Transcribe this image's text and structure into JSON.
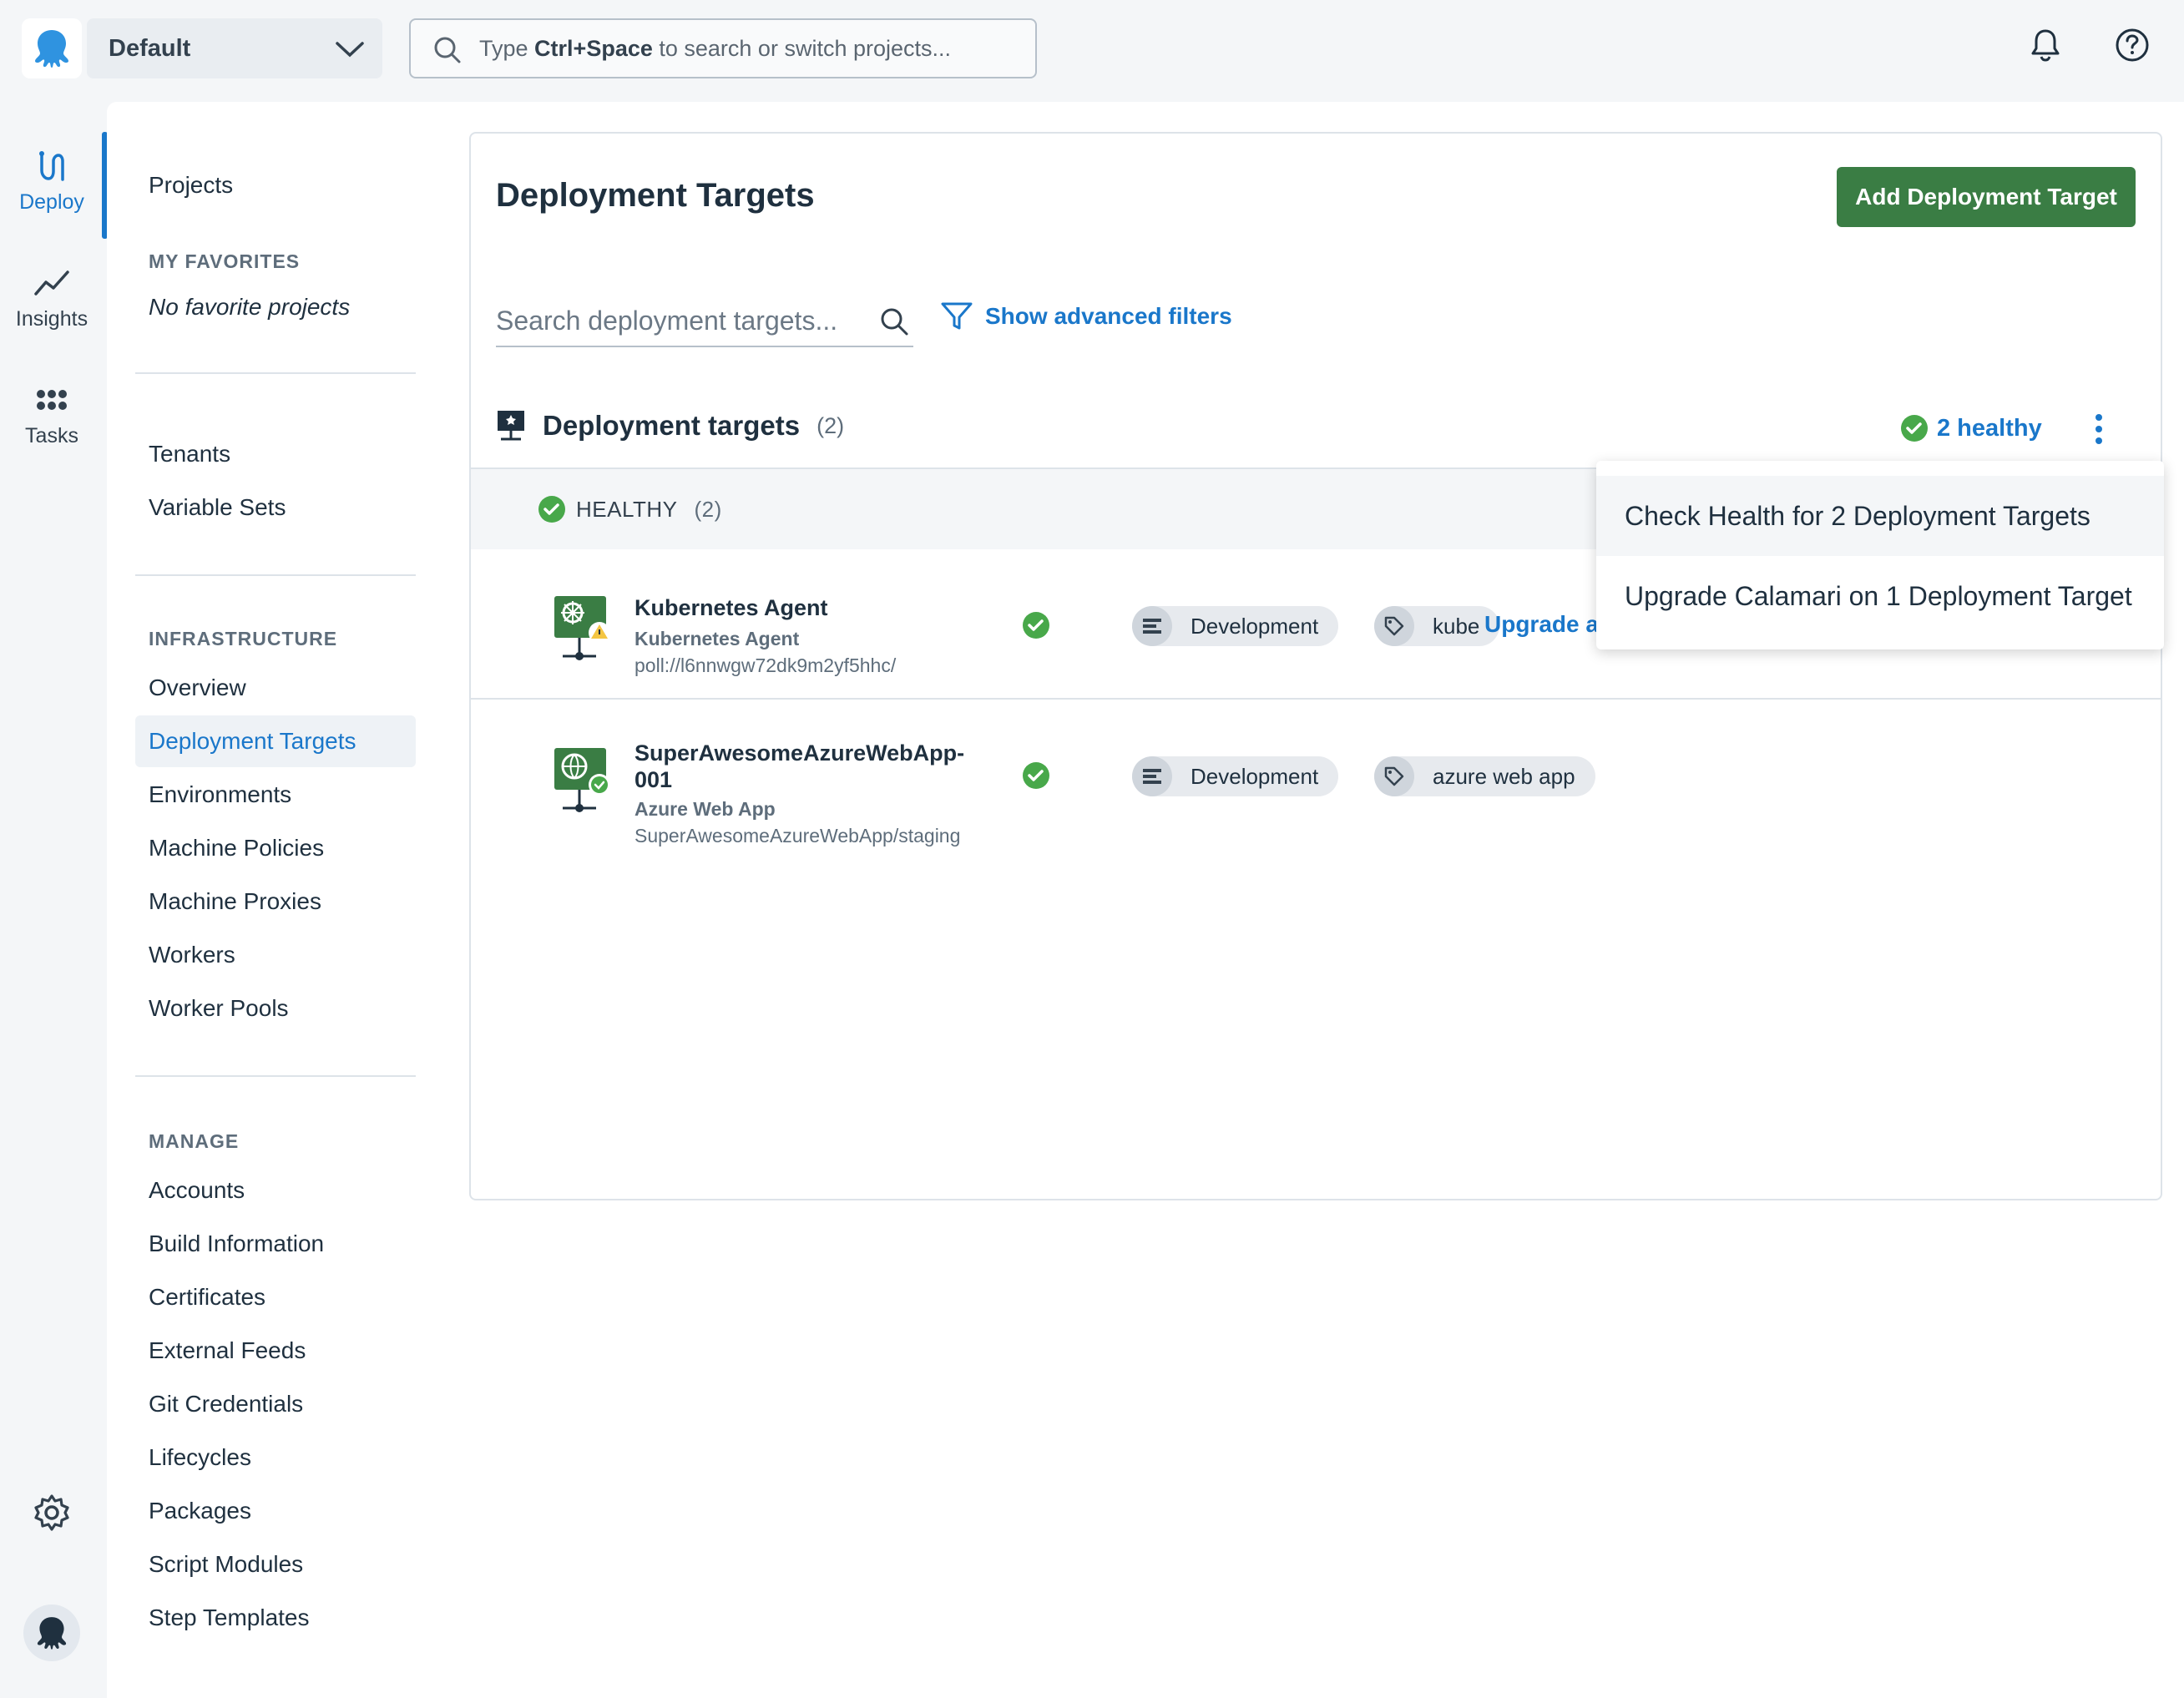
{
  "topbar": {
    "space_name": "Default",
    "search_placeholder_prefix": "Type ",
    "search_shortcut": "Ctrl+Space",
    "search_placeholder_suffix": " to search or switch projects..."
  },
  "rail": {
    "items": [
      {
        "label": "Deploy",
        "icon": "deploy-icon",
        "active": true
      },
      {
        "label": "Insights",
        "icon": "chart-line-icon",
        "active": false
      },
      {
        "label": "Tasks",
        "icon": "grid-dots-icon",
        "active": false
      }
    ]
  },
  "nav": {
    "projects": "Projects",
    "favorites_heading": "MY FAVORITES",
    "favorites_empty": "No favorite projects",
    "tenants": "Tenants",
    "variable_sets": "Variable Sets",
    "infrastructure_heading": "INFRASTRUCTURE",
    "infrastructure": [
      "Overview",
      "Deployment Targets",
      "Environments",
      "Machine Policies",
      "Machine Proxies",
      "Workers",
      "Worker Pools"
    ],
    "manage_heading": "MANAGE",
    "manage": [
      "Accounts",
      "Build Information",
      "Certificates",
      "External Feeds",
      "Git Credentials",
      "Lifecycles",
      "Packages",
      "Script Modules",
      "Step Templates"
    ]
  },
  "page": {
    "title": "Deployment Targets",
    "add_button": "Add Deployment Target",
    "search_placeholder": "Search deployment targets...",
    "advanced_filters": "Show advanced filters",
    "section_title": "Deployment targets",
    "section_count": "(2)",
    "healthy_summary": "2 healthy",
    "group_label": "HEALTHY",
    "group_count": "(2)"
  },
  "targets": [
    {
      "name": "Kubernetes Agent",
      "type": "Kubernetes Agent",
      "uri": "poll://l6nnwgw72dk9m2yf5hhc/",
      "environment": "Development",
      "tag": "kube",
      "upgrade_text": "Upgrade av"
    },
    {
      "name": "SuperAwesomeAzureWebApp-001",
      "type": "Azure Web App",
      "uri": "SuperAwesomeAzureWebApp/staging",
      "environment": "Development",
      "tag": "azure web app"
    }
  ],
  "menu": {
    "items": [
      "Check Health for 2 Deployment Targets",
      "Upgrade Calamari on 1 Deployment Target"
    ]
  },
  "colors": {
    "accent": "#1a77ca",
    "primary_button": "#3a7d44",
    "healthy": "#48a84a"
  }
}
